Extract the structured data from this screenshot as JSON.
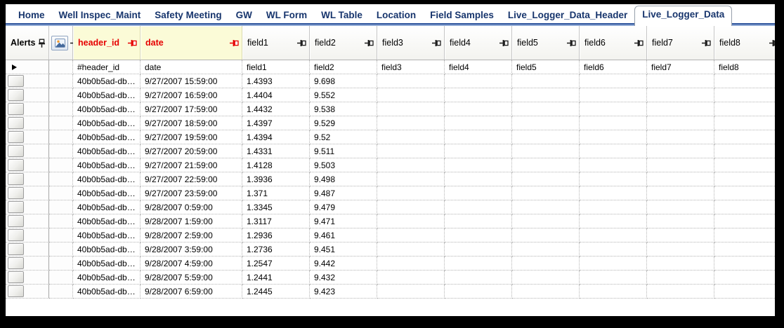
{
  "tab_bar": {
    "tabs": [
      {
        "label": "Home",
        "active": false
      },
      {
        "label": "Well Inspec_Maint",
        "active": false
      },
      {
        "label": "Safety Meeting",
        "active": false
      },
      {
        "label": "GW",
        "active": false
      },
      {
        "label": "WL Form",
        "active": false
      },
      {
        "label": "WL Table",
        "active": false
      },
      {
        "label": "Location",
        "active": false
      },
      {
        "label": "Field Samples",
        "active": false
      },
      {
        "label": "Live_Logger_Data_Header",
        "active": false
      },
      {
        "label": "Live_Logger_Data",
        "active": true
      }
    ]
  },
  "alerts_panel": {
    "title": "Alerts",
    "pin_icon": "pushpin-vertical-icon"
  },
  "icon_column": {
    "icon": "image-icon",
    "pin_icon": "pushpin-horizontal-icon"
  },
  "grid": {
    "columns": [
      {
        "key": "header_id",
        "label": "header_id",
        "emphasis": "key",
        "pin": "red"
      },
      {
        "key": "date",
        "label": "date",
        "emphasis": "key",
        "pin": "red"
      },
      {
        "key": "field1",
        "label": "field1",
        "emphasis": "normal",
        "pin": "black"
      },
      {
        "key": "field2",
        "label": "field2",
        "emphasis": "normal",
        "pin": "black"
      },
      {
        "key": "field3",
        "label": "field3",
        "emphasis": "normal",
        "pin": "black"
      },
      {
        "key": "field4",
        "label": "field4",
        "emphasis": "normal",
        "pin": "black"
      },
      {
        "key": "field5",
        "label": "field5",
        "emphasis": "normal",
        "pin": "black"
      },
      {
        "key": "field6",
        "label": "field6",
        "emphasis": "normal",
        "pin": "black"
      },
      {
        "key": "field7",
        "label": "field7",
        "emphasis": "normal",
        "pin": "black"
      },
      {
        "key": "field8",
        "label": "field8",
        "emphasis": "normal",
        "pin": "black"
      }
    ],
    "field_name_row": [
      "#header_id",
      "date",
      "field1",
      "field2",
      "field3",
      "field4",
      "field5",
      "field6",
      "field7",
      "field8"
    ],
    "rows": [
      {
        "header_id": "40b0b5ad-db…",
        "date": "9/27/2007 15:59:00",
        "field1": "1.4393",
        "field2": "9.698"
      },
      {
        "header_id": "40b0b5ad-db…",
        "date": "9/27/2007 16:59:00",
        "field1": "1.4404",
        "field2": "9.552"
      },
      {
        "header_id": "40b0b5ad-db…",
        "date": "9/27/2007 17:59:00",
        "field1": "1.4432",
        "field2": "9.538"
      },
      {
        "header_id": "40b0b5ad-db…",
        "date": "9/27/2007 18:59:00",
        "field1": "1.4397",
        "field2": "9.529"
      },
      {
        "header_id": "40b0b5ad-db…",
        "date": "9/27/2007 19:59:00",
        "field1": "1.4394",
        "field2": "9.52"
      },
      {
        "header_id": "40b0b5ad-db…",
        "date": "9/27/2007 20:59:00",
        "field1": "1.4331",
        "field2": "9.511"
      },
      {
        "header_id": "40b0b5ad-db…",
        "date": "9/27/2007 21:59:00",
        "field1": "1.4128",
        "field2": "9.503"
      },
      {
        "header_id": "40b0b5ad-db…",
        "date": "9/27/2007 22:59:00",
        "field1": "1.3936",
        "field2": "9.498"
      },
      {
        "header_id": "40b0b5ad-db…",
        "date": "9/27/2007 23:59:00",
        "field1": "1.371",
        "field2": "9.487"
      },
      {
        "header_id": "40b0b5ad-db…",
        "date": "9/28/2007 0:59:00",
        "field1": "1.3345",
        "field2": "9.479"
      },
      {
        "header_id": "40b0b5ad-db…",
        "date": "9/28/2007 1:59:00",
        "field1": "1.3117",
        "field2": "9.471"
      },
      {
        "header_id": "40b0b5ad-db…",
        "date": "9/28/2007 2:59:00",
        "field1": "1.2936",
        "field2": "9.461"
      },
      {
        "header_id": "40b0b5ad-db…",
        "date": "9/28/2007 3:59:00",
        "field1": "1.2736",
        "field2": "9.451"
      },
      {
        "header_id": "40b0b5ad-db…",
        "date": "9/28/2007 4:59:00",
        "field1": "1.2547",
        "field2": "9.442"
      },
      {
        "header_id": "40b0b5ad-db…",
        "date": "9/28/2007 5:59:00",
        "field1": "1.2441",
        "field2": "9.432"
      },
      {
        "header_id": "40b0b5ad-db…",
        "date": "9/28/2007 6:59:00",
        "field1": "1.2445",
        "field2": "9.423"
      }
    ]
  },
  "colors": {
    "frame": "#000000",
    "tab_text": "#17356D",
    "tab_underline_dark": "#31579E",
    "tab_underline_light": "#8FA9D4",
    "key_header_bg": "#FBFBD7",
    "key_header_text": "#E60000",
    "grid_line": "#B4B4B4"
  }
}
